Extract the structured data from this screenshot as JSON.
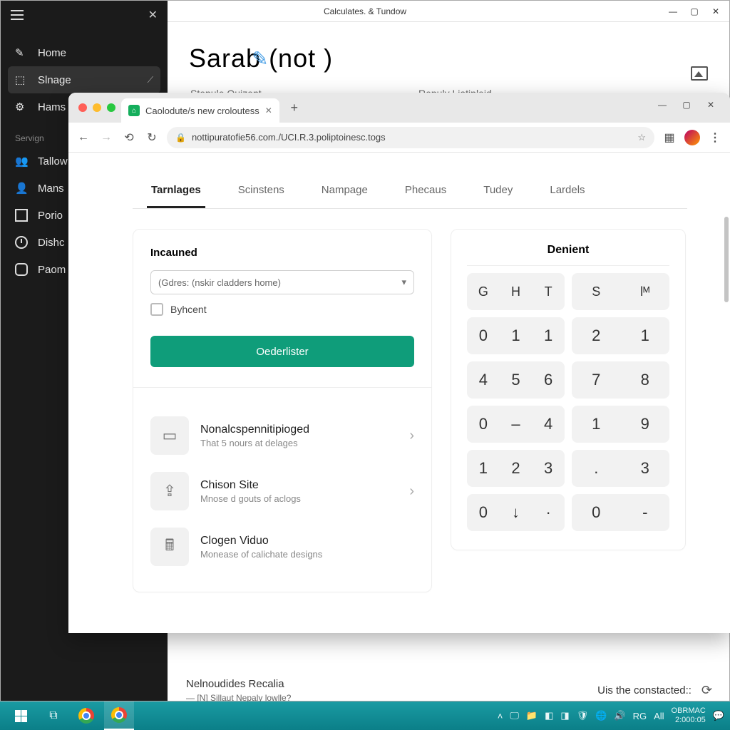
{
  "bgwin": {
    "title": "Calculates. & Tundow",
    "heading": "Sarab (not     )",
    "field1": "Stepule Quizent",
    "field2": "Repuly Liatipleid",
    "bottom_title": "Nelnoudides Recalia",
    "bottom_sub": "— [N] Sillaut Nepaly lowlle?",
    "bottom_right": "Uis the constacted::"
  },
  "sidebar": {
    "items": [
      {
        "label": "Home"
      },
      {
        "label": "Slnage"
      },
      {
        "label": "Hams"
      }
    ],
    "section": "Servign",
    "lower": [
      {
        "label": "Tallow"
      },
      {
        "label": "Mans"
      },
      {
        "label": "Porio"
      },
      {
        "label": "Dishc"
      },
      {
        "label": "Paom"
      }
    ]
  },
  "browser": {
    "tab_title": "Caolodute/s new croloutess",
    "url": "nottipuratofie56.com./UCI.R.3.poliptoinesc.togs"
  },
  "page_tabs": [
    "Tarnlages",
    "Scinstens",
    "Nampage",
    "Phecaus",
    "Tudey",
    "Lardels"
  ],
  "left": {
    "title": "Incauned",
    "select": "(Gdres: (nskir cladders home)",
    "checkbox": "Byhcent",
    "button": "Oederlister",
    "rows": [
      {
        "title": "Nonalcspennitipioged",
        "sub": "That 5 nours at delages"
      },
      {
        "title": "Chison Site",
        "sub": "Mnose d gouts of aclogs"
      },
      {
        "title": "Clogen Viduo",
        "sub": "Monease of calichate designs"
      }
    ]
  },
  "pad": {
    "title": "Denient",
    "rows": [
      [
        [
          "G",
          "H",
          "T"
        ],
        [
          "S",
          "lᴹ"
        ]
      ],
      [
        [
          "0",
          "1",
          "1"
        ],
        [
          "2",
          "1"
        ]
      ],
      [
        [
          "4",
          "5",
          "6"
        ],
        [
          "7",
          "8"
        ]
      ],
      [
        [
          "0",
          "–",
          "4"
        ],
        [
          "1",
          "9"
        ]
      ],
      [
        [
          "1",
          "2",
          "3"
        ],
        [
          ".",
          "3"
        ]
      ],
      [
        [
          "0",
          "↓",
          "·"
        ],
        [
          "0",
          "-"
        ]
      ]
    ]
  },
  "taskbar": {
    "label": "OBRMAC",
    "time": "2:000:05",
    "lang1": "RG",
    "lang2": "All"
  }
}
